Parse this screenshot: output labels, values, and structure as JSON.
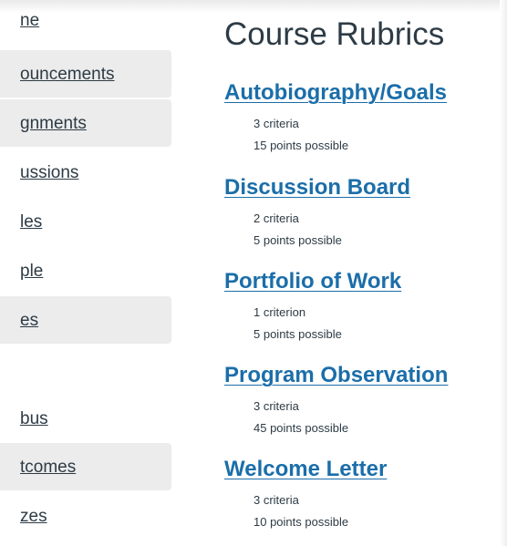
{
  "sidebar": {
    "items": [
      {
        "label": "ne"
      },
      {
        "label": "ouncements"
      },
      {
        "label": "gnments"
      },
      {
        "label": "ussions"
      },
      {
        "label": "les"
      },
      {
        "label": "ple"
      },
      {
        "label": "es"
      },
      {
        "label": ""
      },
      {
        "label": "bus"
      },
      {
        "label": "tcomes"
      },
      {
        "label": "zes"
      }
    ]
  },
  "main": {
    "title": "Course Rubrics",
    "rubrics": [
      {
        "name": "Autobiography/Goals",
        "criteria": "3 criteria",
        "points": "15 points possible"
      },
      {
        "name": "Discussion Board",
        "criteria": "2 criteria",
        "points": "5 points possible"
      },
      {
        "name": "Portfolio of Work",
        "criteria": "1 criterion",
        "points": "5 points possible"
      },
      {
        "name": "Program Observation",
        "criteria": "3 criteria",
        "points": "45 points possible"
      },
      {
        "name": "Welcome Letter",
        "criteria": "3 criteria",
        "points": "10 points possible"
      }
    ]
  },
  "colors": {
    "link": "#1b6ea9",
    "text": "#2d3b45",
    "active_nav_bg": "#ececec"
  }
}
